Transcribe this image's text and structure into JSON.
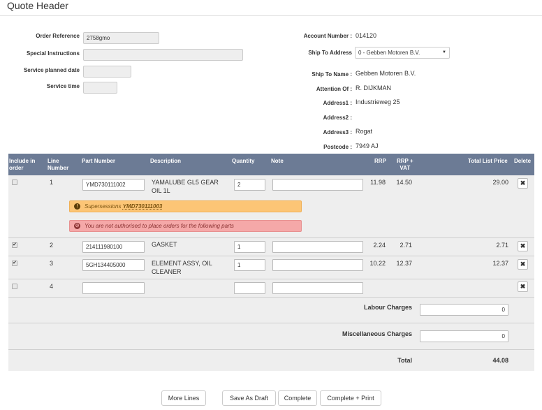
{
  "page": {
    "title": "Quote Header"
  },
  "left_form": {
    "order_reference": {
      "label": "Order Reference",
      "value": "2758gmo"
    },
    "special_instructions": {
      "label": "Special Instructions",
      "value": ""
    },
    "service_planned_date": {
      "label": "Service planned date",
      "value": ""
    },
    "service_time": {
      "label": "Service time",
      "value": ""
    }
  },
  "right_form": {
    "account_number": {
      "label": "Account Number :",
      "value": "014120"
    },
    "ship_to_address": {
      "label": "Ship To Address",
      "value": "0 - Gebben Motoren B.V."
    },
    "ship_to_name": {
      "label": "Ship To Name :",
      "value": "Gebben Motoren B.V."
    },
    "attention_of": {
      "label": "Attention Of :",
      "value": "R. DIJKMAN"
    },
    "address1": {
      "label": "Address1 :",
      "value": "Industrieweg 25"
    },
    "address2": {
      "label": "Address2 :",
      "value": ""
    },
    "address3": {
      "label": "Address3 :",
      "value": "Rogat"
    },
    "postcode": {
      "label": "Postcode :",
      "value": "7949 AJ"
    }
  },
  "table": {
    "headers": {
      "include_line1": "Include in",
      "include_line2": "order",
      "line_line1": "Line",
      "line_line2": "Number",
      "part": "Part Number",
      "desc": "Description",
      "qty": "Quantity",
      "note": "Note",
      "rrp": "RRP",
      "rrpvat_line1": "RRP +",
      "rrpvat_line2": "VAT",
      "total": "Total List Price",
      "delete": "Delete"
    },
    "rows": [
      {
        "checked": false,
        "line": "1",
        "part": "YMD730111002",
        "desc_line1": "YAMALUBE GL5 GEAR",
        "desc_line2": "OIL 1L",
        "qty": "2",
        "note": "",
        "rrp": "11.98",
        "rrp_vat": "14.50",
        "total": "29.00"
      },
      {
        "checked": true,
        "line": "2",
        "part": "214111980100",
        "desc_line1": "GASKET",
        "desc_line2": "",
        "qty": "1",
        "note": "",
        "rrp": "2.24",
        "rrp_vat": "2.71",
        "total": "2.71"
      },
      {
        "checked": true,
        "line": "3",
        "part": "5GH134405000",
        "desc_line1": "ELEMENT ASSY, OIL",
        "desc_line2": "CLEANER",
        "qty": "1",
        "note": "",
        "rrp": "10.22",
        "rrp_vat": "12.37",
        "total": "12.37"
      },
      {
        "checked": false,
        "line": "4",
        "part": "",
        "desc_line1": "",
        "desc_line2": "",
        "qty": "",
        "note": "",
        "rrp": "",
        "rrp_vat": "",
        "total": ""
      }
    ],
    "alerts": {
      "supersession_prefix": "Supersessions",
      "supersession_part": "YMD730111003",
      "not_authorised": "You are not authorised to place orders for the following parts"
    },
    "delete_glyph": "✖",
    "check_glyph": "✔"
  },
  "summary": {
    "labour_label": "Labour Charges",
    "labour_value": "0",
    "misc_label": "Miscellaneous Charges",
    "misc_value": "0",
    "total_label": "Total",
    "total_value": "44.08"
  },
  "buttons": {
    "more_lines": "More Lines",
    "save_draft": "Save As Draft",
    "complete": "Complete",
    "complete_print": "Complete + Print"
  }
}
